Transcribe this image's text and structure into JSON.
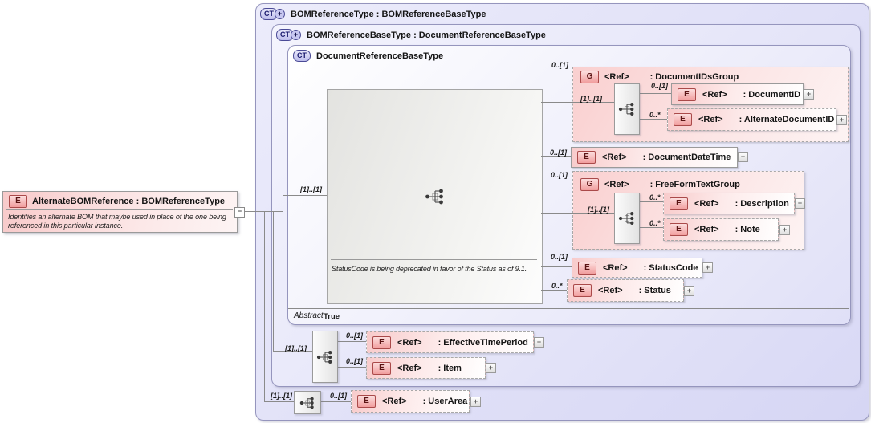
{
  "colors": {
    "container_lavender": "#d9d9f5",
    "element_pink": "#f8cbcb",
    "badge_pink": "#f19e9e",
    "badge_border_red": "#aa4a4a",
    "ct_badge_lavender": "#bdbdec",
    "panel_gray": "#e3e3e0",
    "line_gray": "#8a8a8a"
  },
  "badges": {
    "element": "E",
    "group": "G",
    "complex_type": "CT"
  },
  "icons": {
    "expand": "+",
    "collapse": "−",
    "derived_plus": "+"
  },
  "left_element": {
    "title": "AlternateBOMReference : BOMReferenceType",
    "annotation": "Identifies an alternate BOM that maybe used in place of the one being referenced in this particular instance."
  },
  "containers": {
    "bom_reference_type": {
      "title": "BOMReferenceType : BOMReferenceBaseType"
    },
    "bom_reference_base_type": {
      "title": "BOMReferenceBaseType : DocumentReferenceBaseType"
    },
    "document_reference_base_type": {
      "title": "DocumentReferenceBaseType",
      "abstract_label": "Abstract",
      "abstract_value": "True",
      "deprecation_note": "StatusCode is being deprecated in favor of the Status as of 9.1."
    }
  },
  "cardinalities": {
    "inner_sequence": "[1]..[1]",
    "middle_sequence": "[1]..[1]",
    "outer_sequence": "[1]..[1]",
    "document_ids_group_sequence": "[1]..[1]",
    "free_form_text_group_sequence": "[1]..[1]"
  },
  "elements": {
    "document_ids_group": {
      "ref": "<Ref>",
      "name": ": DocumentIDsGroup",
      "cardinality": "0..[1]"
    },
    "document_id": {
      "ref": "<Ref>",
      "name": ": DocumentID",
      "cardinality": "0..[1]"
    },
    "alternate_document_id": {
      "ref": "<Ref>",
      "name": ": AlternateDocumentID",
      "cardinality": "0..*"
    },
    "document_date_time": {
      "ref": "<Ref>",
      "name": ": DocumentDateTime",
      "cardinality": "0..[1]"
    },
    "free_form_text_group": {
      "ref": "<Ref>",
      "name": ": FreeFormTextGroup",
      "cardinality": "0..[1]"
    },
    "description": {
      "ref": "<Ref>",
      "name": ": Description",
      "cardinality": "0..*"
    },
    "note": {
      "ref": "<Ref>",
      "name": ": Note",
      "cardinality": "0..*"
    },
    "status_code": {
      "ref": "<Ref>",
      "name": ": StatusCode",
      "cardinality": "0..[1]"
    },
    "status": {
      "ref": "<Ref>",
      "name": ": Status",
      "cardinality": "0..*"
    },
    "effective_time_period": {
      "ref": "<Ref>",
      "name": ": EffectiveTimePeriod",
      "cardinality": "0..[1]"
    },
    "item": {
      "ref": "<Ref>",
      "name": ": Item",
      "cardinality": "0..[1]"
    },
    "user_area": {
      "ref": "<Ref>",
      "name": ": UserArea",
      "cardinality": "0..[1]"
    }
  }
}
